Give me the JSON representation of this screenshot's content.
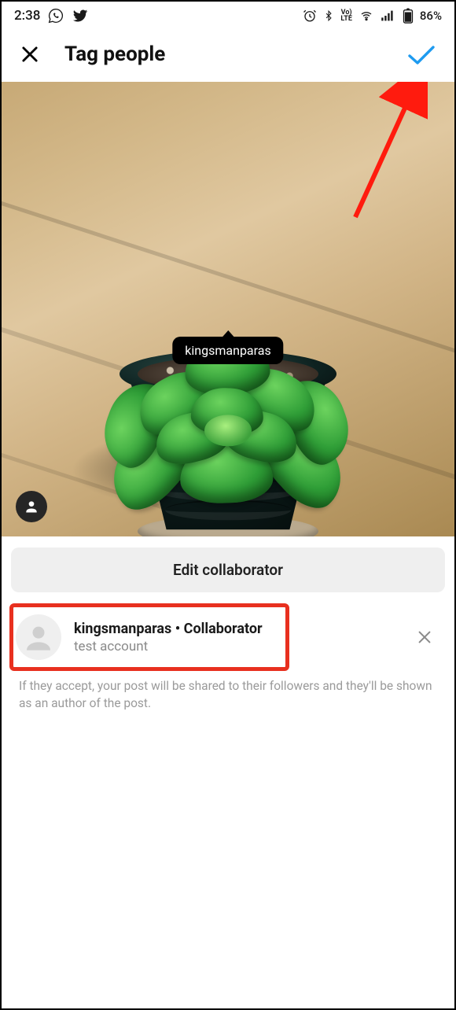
{
  "status": {
    "time": "2:38",
    "battery_text": "86%"
  },
  "header": {
    "title": "Tag people"
  },
  "photo": {
    "tag_username": "kingsmanparas"
  },
  "actions": {
    "edit_collaborator_label": "Edit collaborator"
  },
  "collaborator": {
    "username": "kingsmanparas",
    "role_suffix": " • Collaborator",
    "display_name": "test account"
  },
  "hint": "If they accept, your post will be shared to their followers and they'll be shown as an author of the post."
}
